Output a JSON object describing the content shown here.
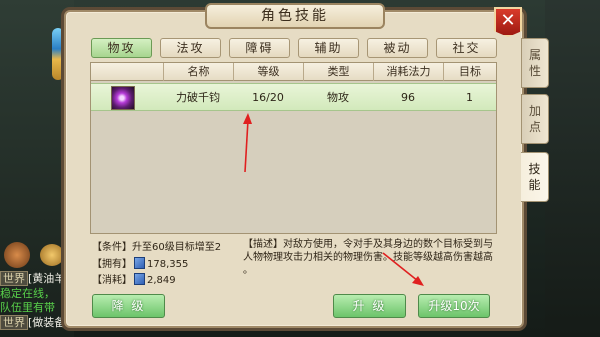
{
  "window": {
    "title": "角色技能",
    "close_glyph": "✕"
  },
  "tabs": [
    {
      "label": "物攻",
      "active": true
    },
    {
      "label": "法攻",
      "active": false
    },
    {
      "label": "障碍",
      "active": false
    },
    {
      "label": "辅助",
      "active": false
    },
    {
      "label": "被动",
      "active": false
    },
    {
      "label": "社交",
      "active": false
    }
  ],
  "side_tabs": [
    {
      "label": "属\n性",
      "active": false
    },
    {
      "label": "加\n点",
      "active": false
    },
    {
      "label": "技\n能",
      "active": true
    }
  ],
  "table": {
    "columns": [
      "名称",
      "等级",
      "类型",
      "消耗法力",
      "目标"
    ],
    "rows": [
      {
        "icon": "skill-icon",
        "name": "力破千钧",
        "level": "16/20",
        "type": "物攻",
        "mana": "96",
        "target": "1"
      }
    ]
  },
  "details": {
    "condition_label": "【条件】",
    "condition_value": "升至60级目标增至2",
    "owned_label": "【拥有】",
    "owned_value": "178,355",
    "cost_label": "【消耗】",
    "cost_value": "2,849",
    "description_label": "【描述】",
    "description_line1": "对敌方使用，令对手及其身边的数个目标受到与",
    "description_line2": "人物物理攻击力相关的物理伤害。技能等级越高伤害越高",
    "description_line3": "。"
  },
  "buttons": {
    "downgrade": "降 级",
    "upgrade": "升 级",
    "upgrade10": "升级10次"
  },
  "chat": [
    {
      "tag": "世界",
      "text": "[黄油羊"
    },
    {
      "tag": "",
      "text": "稳定在线，"
    },
    {
      "tag": "",
      "text": "队伍里有带"
    },
    {
      "tag": "世界",
      "text": "[做装备"
    }
  ],
  "colors": {
    "accent_green": "#6cc46a",
    "close_red": "#c42a1d",
    "arrow_red": "#e02020"
  }
}
